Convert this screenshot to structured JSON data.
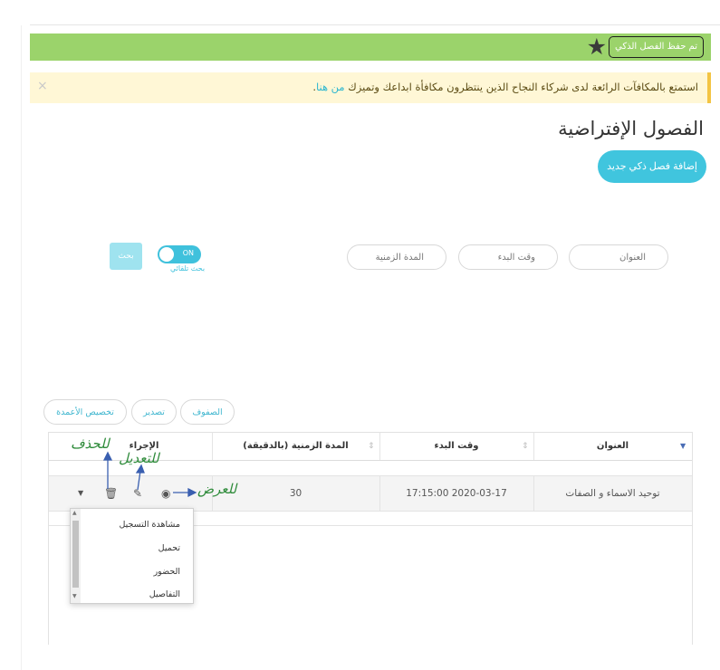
{
  "success_message": "تم حفظ الفصل الذكي",
  "notice": {
    "text": "استمتع بالمكافآت الرائعة لدى شركاء النجاح الذين ينتظرون مكافأة ابداعك وتميزك",
    "link": "من هنا",
    "close": "×"
  },
  "page_title": "الفصول الإفتراضية",
  "add_button": "إضافة فصل ذكي جديد",
  "filters": {
    "title_placeholder": "العنوان",
    "start_placeholder": "وقت البدء",
    "duration_placeholder": "المدة الزمنية",
    "toggle_state": "ON",
    "toggle_label": "بحث تلقائي",
    "search_button": "بحث"
  },
  "table_tools": [
    "الصفوف",
    "تصدير",
    "تخصيص الأعمدة"
  ],
  "table": {
    "columns": [
      "العنوان",
      "وقت البدء",
      "المدة الزمنية (بالدقيقة)",
      "الإجراء"
    ],
    "rows": [
      {
        "title": "توحيد الاسماء و الصفات",
        "start": "17:15:00 2020-03-17",
        "duration": "30"
      }
    ]
  },
  "action_menu": [
    "مشاهدة التسجيل",
    "تحميل",
    "الحضور",
    "التفاصيل"
  ],
  "annotations": {
    "delete": "للحذف",
    "edit": "للتعديل",
    "view": "للعرض"
  },
  "colors": {
    "success": "#9bd36b",
    "accent": "#40c5de",
    "notice_bg": "#fff7d6",
    "annotation": "#2e8b3a",
    "arrow": "#3a5fb0"
  },
  "icons": [
    "star-icon",
    "close-icon",
    "sort-icon",
    "eye-icon",
    "pencil-icon",
    "trash-icon",
    "chevron-down-icon"
  ]
}
